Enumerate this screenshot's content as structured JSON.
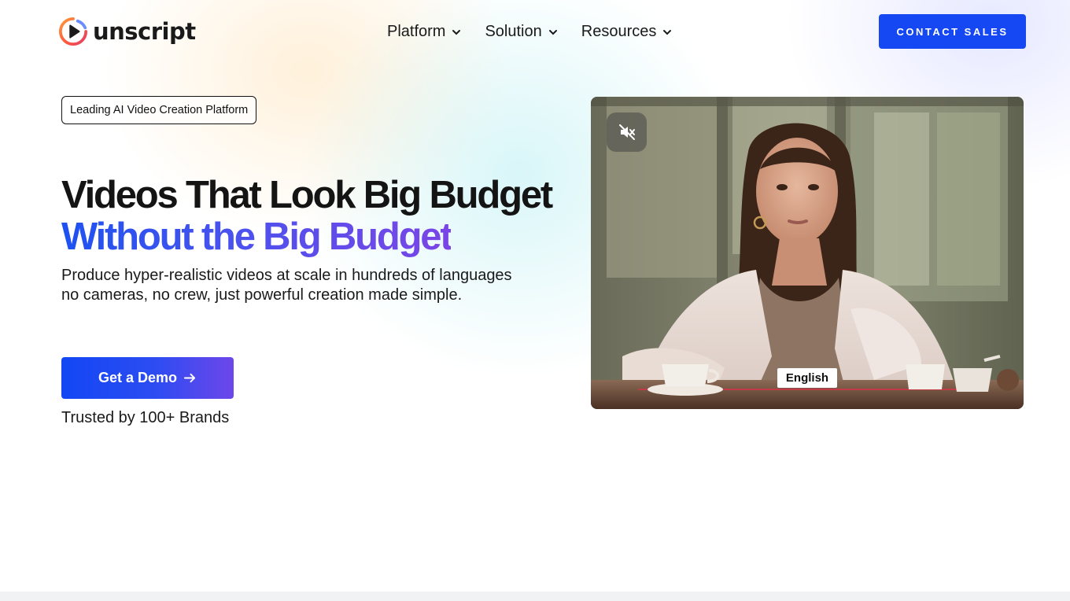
{
  "brand": {
    "name": "unscript",
    "logo_icon": "play-circle-icon",
    "accent": "#1547f2",
    "gradient": [
      "#1d52f0",
      "#7b45e6"
    ]
  },
  "nav": {
    "items": [
      {
        "label": "Platform",
        "icon": "chevron-down-icon"
      },
      {
        "label": "Solution",
        "icon": "chevron-down-icon"
      },
      {
        "label": "Resources",
        "icon": "chevron-down-icon"
      }
    ],
    "cta": "CONTACT SALES"
  },
  "hero": {
    "badge": "Leading AI Video Creation Platform",
    "headline_line1": "Videos That Look Big Budget",
    "headline_line2": "Without the Big Budget",
    "subtext_line1": "Produce hyper-realistic videos at scale in hundreds of languages",
    "subtext_line2": "no cameras, no crew, just powerful creation made simple.",
    "cta": "Get a Demo",
    "cta_icon": "arrow-right-icon",
    "trusted": "Trusted by 100+ Brands"
  },
  "video": {
    "mute_icon": "volume-muted-icon",
    "language_label": "English"
  }
}
